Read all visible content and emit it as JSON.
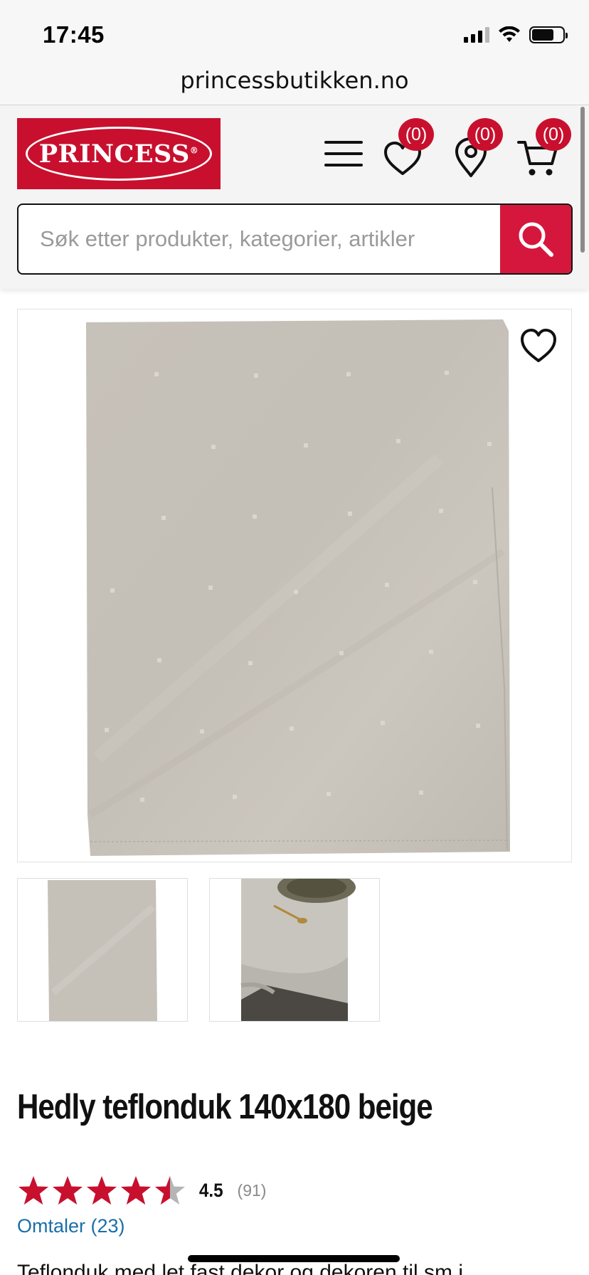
{
  "status_bar": {
    "time": "17:45"
  },
  "browser": {
    "url": "princessbutikken.no"
  },
  "header": {
    "logo_text": "PRINCESS",
    "logo_mark": "®",
    "wishlist_count": "(0)",
    "stores_count": "(0)",
    "cart_count": "(0)",
    "icons": [
      "menu-icon",
      "heart-icon",
      "location-pin-icon",
      "cart-icon",
      "search-icon"
    ]
  },
  "search": {
    "placeholder": "Søk etter produkter, kategorier, artikler",
    "value": ""
  },
  "product": {
    "title": "Hedly teflonduk 140x180 beige",
    "rating_value": "4.5",
    "rating_stars": 4.5,
    "rating_max": 5,
    "rating_count": "(91)",
    "reviews_link": "Omtaler (23)",
    "description_cut": "Teflonduk med let fast dekor og dekoren til sm i"
  },
  "colors": {
    "brand_red": "#c8102e",
    "search_red": "#d6173d",
    "link_blue": "#1a6fa8",
    "star_red": "#c8102e",
    "star_empty": "#b5b5b5"
  }
}
